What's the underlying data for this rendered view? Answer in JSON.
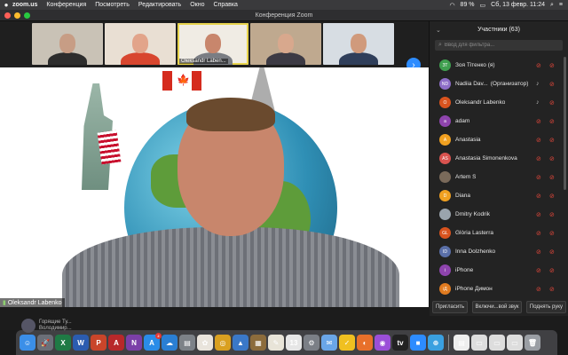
{
  "menubar": {
    "app": "zoom.us",
    "menus": [
      "Конференция",
      "Посмотреть",
      "Редактировать",
      "Окно",
      "Справка"
    ],
    "battery": "89 %",
    "datetime": "Сб, 13 февр.  11:24"
  },
  "window": {
    "title": "Конференция Zoom"
  },
  "gallery": {
    "thumbs": [
      {
        "label": "",
        "bg": "#c9c2b6",
        "face": "#c79d85",
        "body": "#2d2d2d"
      },
      {
        "label": "",
        "bg": "#e9dfd3",
        "face": "#e2a48a",
        "body": "#d8462f"
      },
      {
        "label": "Oleksandr Laben...",
        "bg": "#f0ece4",
        "face": "#c8866c",
        "body": "#7a7d83"
      },
      {
        "label": "",
        "bg": "#bfa98f",
        "face": "#d8a88d",
        "body": "#3c3a44"
      },
      {
        "label": "",
        "bg": "#d7dde3",
        "face": "#d09a7c",
        "body": "#2f3e5a"
      }
    ]
  },
  "main_video": {
    "speaker_label": "Oleksandr Labenko",
    "flag_leaf": "🍁"
  },
  "notification": {
    "line1": "Горящие Ту...",
    "line2": "Володимир..."
  },
  "participants": {
    "title": "Участники (63)",
    "search_placeholder": "Ввод для фильтра...",
    "items": [
      {
        "initials": "ЗТ",
        "name": "Зоя Тітенко (я)",
        "role": "",
        "color": "#3f9f4f",
        "mic": "muted"
      },
      {
        "initials": "ND",
        "name": "Nadiia Dav...",
        "role": "(Организатор)",
        "color": "#8e6ec8",
        "mic": "on"
      },
      {
        "initials": "O",
        "name": "Oleksandr Labenko",
        "role": "",
        "color": "#d9531e",
        "mic": "on"
      },
      {
        "initials": "a",
        "name": "adam",
        "role": "",
        "color": "#8e44ad",
        "mic": "muted"
      },
      {
        "initials": "A",
        "name": "Anastasia",
        "role": "",
        "color": "#f0a020",
        "mic": "muted"
      },
      {
        "initials": "AS",
        "name": "Anastasia Simonenkova",
        "role": "",
        "color": "#d9534f",
        "mic": "muted"
      },
      {
        "initials": "",
        "name": "Artem S",
        "role": "",
        "color": "#7a6a5a",
        "mic": "muted"
      },
      {
        "initials": "D",
        "name": "Diana",
        "role": "",
        "color": "#f0a020",
        "mic": "muted"
      },
      {
        "initials": "",
        "name": "Dmitry Kodrik",
        "role": "",
        "color": "#9aa4ad",
        "mic": "muted"
      },
      {
        "initials": "GL",
        "name": "Glòria Lasterra",
        "role": "",
        "color": "#d9531e",
        "mic": "muted"
      },
      {
        "initials": "ID",
        "name": "Inna Dolzhenko",
        "role": "",
        "color": "#5a6fa8",
        "mic": "muted"
      },
      {
        "initials": "i",
        "name": "iPhone",
        "role": "",
        "color": "#8e44ad",
        "mic": "muted"
      },
      {
        "initials": "iД",
        "name": "iPhone Димон",
        "role": "",
        "color": "#e07b20",
        "mic": "muted"
      }
    ],
    "footer": {
      "invite": "Пригласить",
      "unmute": "Включи...вой звук",
      "raise_hand": "Поднять руку"
    }
  },
  "dock": {
    "apps": [
      {
        "name": "finder-app",
        "glyph": "☺",
        "color": "#3b8fe8"
      },
      {
        "name": "launchpad-app",
        "glyph": "🚀",
        "color": "#6b6f78"
      },
      {
        "name": "excel-app",
        "glyph": "X",
        "color": "#1f7a45"
      },
      {
        "name": "word-app",
        "glyph": "W",
        "color": "#2b5cb0"
      },
      {
        "name": "powerpoint-app",
        "glyph": "P",
        "color": "#c9452a"
      },
      {
        "name": "acrobat-app",
        "glyph": "A",
        "color": "#b8282a"
      },
      {
        "name": "onenote-app",
        "glyph": "N",
        "color": "#7b3fa8"
      },
      {
        "name": "appstore-app",
        "glyph": "A",
        "color": "#2a8ce8",
        "badge": "2"
      },
      {
        "name": "onedrive-app",
        "glyph": "☁",
        "color": "#2a7fd4"
      },
      {
        "name": "notes-app",
        "glyph": "▤",
        "color": "#7d8288"
      },
      {
        "name": "photos-app",
        "glyph": "✿",
        "color": "#e9e4dc"
      },
      {
        "name": "chrome-app",
        "glyph": "◎",
        "color": "#d9a020"
      },
      {
        "name": "keynote-app",
        "glyph": "▲",
        "color": "#3a78c8"
      },
      {
        "name": "preview-app",
        "glyph": "▦",
        "color": "#8c6c3c"
      },
      {
        "name": "textedit-app",
        "glyph": "✎",
        "color": "#e8e4d8"
      },
      {
        "name": "calendar-app",
        "glyph": "13",
        "color": "#e6e6e6"
      },
      {
        "name": "sysprefs-app",
        "glyph": "⚙",
        "color": "#7b7f86"
      },
      {
        "name": "mail-app",
        "glyph": "✉",
        "color": "#6aa6e8"
      },
      {
        "name": "norton-app",
        "glyph": "✓",
        "color": "#f0c020"
      },
      {
        "name": "firefox-app",
        "glyph": "◐",
        "color": "#e8702a"
      },
      {
        "name": "podcasts-app",
        "glyph": "◉",
        "color": "#9b4fd8"
      },
      {
        "name": "tv-app",
        "glyph": "tv",
        "color": "#222"
      },
      {
        "name": "zoom-app",
        "glyph": "■",
        "color": "#2d8cff"
      },
      {
        "name": "safari-app",
        "glyph": "⊕",
        "color": "#3aa0e0"
      }
    ],
    "right": [
      {
        "name": "document-app",
        "glyph": "▤",
        "color": "#eee"
      },
      {
        "name": "window-app",
        "glyph": "▭",
        "color": "#ddd"
      },
      {
        "name": "window2-app",
        "glyph": "▭",
        "color": "#ddd"
      },
      {
        "name": "window3-app",
        "glyph": "▭",
        "color": "#ddd"
      },
      {
        "name": "trash-app",
        "glyph": "🗑",
        "color": "#9a9ea4"
      }
    ]
  },
  "icons": {
    "mic_muted": "🎤",
    "cam_muted": "✕",
    "search": "⌕",
    "next": "›",
    "chevron": "⌄",
    "signal": "▮"
  }
}
